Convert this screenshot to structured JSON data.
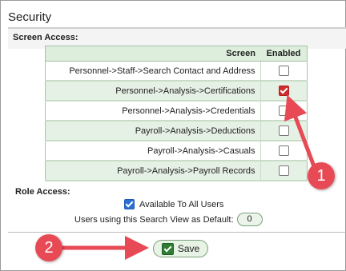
{
  "header": {
    "title": "Security"
  },
  "screen_access": {
    "label": "Screen Access:",
    "columns": {
      "screen": "Screen",
      "enabled": "Enabled"
    },
    "rows": [
      {
        "name": "Personnel->Staff->Search Contact and Address",
        "enabled": false
      },
      {
        "name": "Personnel->Analysis->Certifications",
        "enabled": true
      },
      {
        "name": "Personnel->Analysis->Credentials",
        "enabled": false
      },
      {
        "name": "Payroll->Analysis->Deductions",
        "enabled": false
      },
      {
        "name": "Payroll->Analysis->Casuals",
        "enabled": false
      },
      {
        "name": "Payroll->Analysis->Payroll Records",
        "enabled": false
      }
    ]
  },
  "role_access": {
    "label": "Role Access:",
    "available_to_all_label": "Available To All Users",
    "available_to_all": true,
    "default_users_label": "Users using this Search View as Default:",
    "default_users_count": "0"
  },
  "footer": {
    "save_label": "Save"
  },
  "callouts": {
    "one": "1",
    "two": "2"
  },
  "colors": {
    "callout": "#e84a55",
    "accent_green": "#2f7d32",
    "checkbox_red": "#d12b2b"
  }
}
